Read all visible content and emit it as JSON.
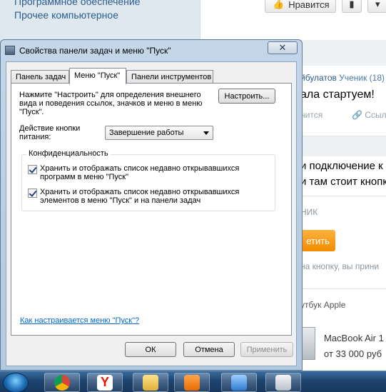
{
  "background_page": {
    "left_menu": [
      "Программное обеспечение",
      "Прочее компьютерное"
    ],
    "like_label": "Нравится",
    "author_fragment": "йбулатов",
    "author_rank": "Ученик (18)",
    "post_fragment": "ала стартуем!",
    "action_1": "нится",
    "action_2": "Ссыл",
    "answer_line_1": "и подключение к",
    "answer_line_2": "и там стоит кнопк",
    "section_label": "НИК",
    "orange_button": "етить",
    "hint_text": "на кнопку, вы прини",
    "ad_heading": "утбук Apple",
    "ad_product": "MacBook Air 1",
    "ad_price": "от 33 000 руб"
  },
  "window": {
    "title": "Свойства панели задач и меню \"Пуск\"",
    "close_symbol": "✕",
    "tabs": [
      {
        "label": "Панель задач",
        "active": false
      },
      {
        "label": "Меню \"Пуск\"",
        "active": true
      },
      {
        "label": "Панели инструментов",
        "active": false
      }
    ],
    "description": "Нажмите \"Настроить\" для определения внешнего вида и поведения ссылок, значков и меню в меню \"Пуск\".",
    "configure_button": "Настроить...",
    "power_label": "Действие кнопки питания:",
    "power_value": "Завершение работы",
    "privacy": {
      "title": "Конфиденциальность",
      "items": [
        {
          "label": "Хранить и отображать список недавно открывавшихся программ в меню \"Пуск\"",
          "checked": true
        },
        {
          "label": "Хранить и отображать список недавно открывавшихся элементов в меню \"Пуск\" и на панели задач",
          "checked": true
        }
      ]
    },
    "help_link": "Как настраивается меню \"Пуск\"?",
    "buttons": {
      "ok": "ОК",
      "cancel": "Отмена",
      "apply": "Применить"
    }
  },
  "taskbar": {
    "items": [
      "start-orb",
      "chrome-icon",
      "yandex-browser-icon",
      "folder-icon",
      "media-player-icon",
      "control-panel-icon",
      "document-icon"
    ]
  }
}
